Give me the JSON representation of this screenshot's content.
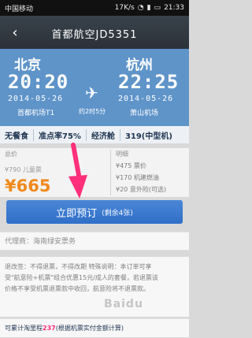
{
  "status": {
    "carrier": "中国移动",
    "speed": "17K/s",
    "time": "21:33"
  },
  "header": {
    "title": "首都航空JD5351"
  },
  "flight": {
    "departure_city": "北京",
    "arrival_city": "杭州",
    "departure_time": "20:20",
    "arrival_time": "22:25",
    "departure_date": "2014-05-26",
    "arrival_date": "2014-05-26",
    "departure_airport": "首都机场T1",
    "arrival_airport": "萧山机场",
    "duration": "约2时5分"
  },
  "tags": [
    "无餐食",
    "准点率75%",
    "经济舱",
    "319(中型机)"
  ],
  "pricing": {
    "total_label": "总价",
    "original_price": "¥790",
    "child_label": "儿童票",
    "current_price": "¥665",
    "details_label": "明细",
    "ticket_price": "¥475",
    "ticket_label": "票价",
    "fee_price": "¥170",
    "fee_label": "机建燃油",
    "insurance_price": "¥20",
    "insurance_label": "意外险(可选)"
  },
  "booking": {
    "button_label": "立即预订",
    "remaining": "(剩余4张)"
  },
  "agent": {
    "text": "代理商：海南绿安票务"
  },
  "notes": {
    "line1": "退改签：不得退票，不得改期 特殊说明：本订单可享",
    "line2": "受\"航意险+机票\"组合优惠15元/成人的套餐，若退票该",
    "line3": "价格不享受机票退票款中收回，航意险将不退票款。"
  },
  "miles": {
    "text_before": "可累计淘里程",
    "value": "237",
    "text_after": "(根据机票实付金额计算)"
  },
  "watermark": {
    "text": "Baidu"
  },
  "colors": {
    "flight_bg": "#5f94c9",
    "accent_orange": "#f08a1c",
    "button_blue": "#2f6fc8",
    "annotation_pink": "#ff2f7b"
  }
}
